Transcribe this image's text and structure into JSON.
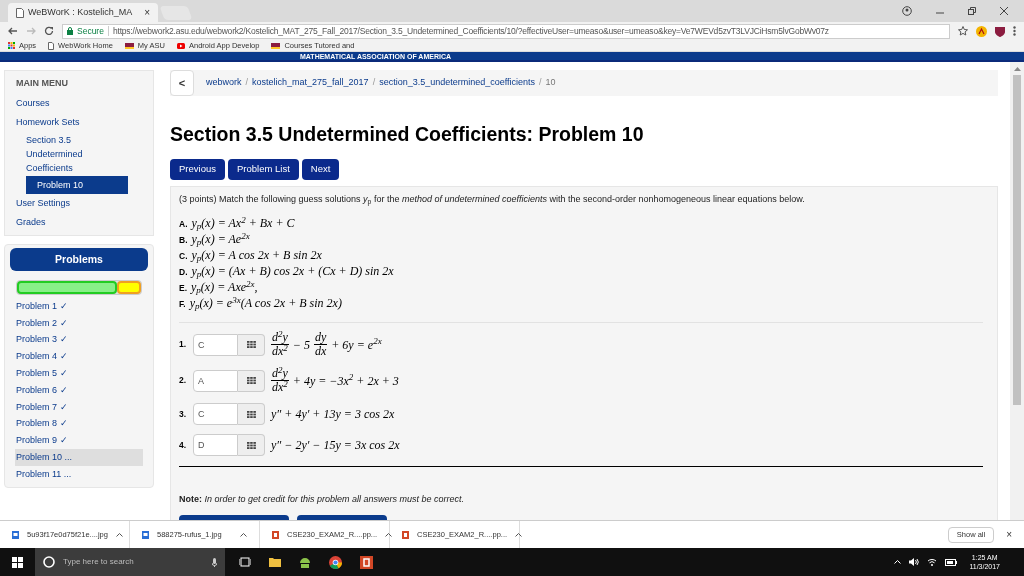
{
  "browser": {
    "tab": {
      "title": "WeBWorK : Kostelich_MA",
      "close": "×"
    },
    "secure": "Secure",
    "url": "https://webwork2.asu.edu/webwork2/Kostelich_MAT_275_Fall_2017/Section_3.5_Undetermined_Coefficients/10/?effectiveUser=umeaso&user=umeaso&key=Ve7WEVd5zvT3LVJCiHsm5lvGobWv07z",
    "bookmarks": [
      {
        "label": "Apps",
        "kind": "apps"
      },
      {
        "label": "WebWork Home",
        "kind": "page"
      },
      {
        "label": "My ASU",
        "kind": "asu"
      },
      {
        "label": "Android App Develop",
        "kind": "youtube"
      },
      {
        "label": "Courses Tutored and",
        "kind": "asu"
      }
    ]
  },
  "banner": {
    "text": "MATHEMATICAL ASSOCIATION OF AMERICA"
  },
  "sidebar": {
    "menu_title": "MAIN MENU",
    "items": [
      {
        "label": "Courses",
        "selected": false
      },
      {
        "label": "Homework Sets",
        "selected": false,
        "children": [
          {
            "label": "Section 3.5 Undetermined Coefficients",
            "selected": false,
            "children": [
              {
                "label": "Problem 10",
                "selected": true
              }
            ]
          }
        ]
      },
      {
        "label": "User Settings",
        "selected": false
      },
      {
        "label": "Grades",
        "selected": false
      }
    ],
    "problems_title": "Problems",
    "progress": {
      "level": 0.81
    },
    "problems": [
      {
        "label": "Problem 1 ✓",
        "selected": false
      },
      {
        "label": "Problem 2 ✓",
        "selected": false
      },
      {
        "label": "Problem 3 ✓",
        "selected": false
      },
      {
        "label": "Problem 4 ✓",
        "selected": false
      },
      {
        "label": "Problem 5 ✓",
        "selected": false
      },
      {
        "label": "Problem 6 ✓",
        "selected": false
      },
      {
        "label": "Problem 7 ✓",
        "selected": false
      },
      {
        "label": "Problem 8 ✓",
        "selected": false
      },
      {
        "label": "Problem 9 ✓",
        "selected": false
      },
      {
        "label": "Problem 10 ...",
        "selected": true
      },
      {
        "label": "Problem 11 ...",
        "selected": false
      }
    ]
  },
  "breadcrumb": {
    "back": "<",
    "links": [
      "webwork",
      "kostelich_mat_275_fall_2017",
      "section_3.5_undetermined_coefficients"
    ],
    "current": "10",
    "separator": "/"
  },
  "title": "Section 3.5 Undetermined Coefficients: Problem 10",
  "buttons": [
    "Previous",
    "Problem List",
    "Next"
  ],
  "problem": {
    "intro": "(3 points) Match the following guess solutions *y*$_{p}$ for the *method of undetermined coefficients* with the second-order nonhomogeneous linear equations below.",
    "options": [
      {
        "letter": "A.",
        "formula": "y$_{p}$(x) = Ax$^{2}$ + Bx + C"
      },
      {
        "letter": "B.",
        "formula": "y$_{p}$(x) = Ae$^{2x}$"
      },
      {
        "letter": "C.",
        "formula": "y$_{p}$(x) = A cos 2x + B sin 2x"
      },
      {
        "letter": "D.",
        "formula": "y$_{p}$(x) = (Ax + B) cos 2x + (Cx + D) sin 2x"
      },
      {
        "letter": "E.",
        "formula": "y$_{p}$(x) = Axe$^{2x}$,"
      },
      {
        "letter": "F.",
        "formula": "y$_{p}$(x) = e$^{3x}$(A cos 2x + B sin 2x)"
      }
    ],
    "questions": [
      {
        "number": "1.",
        "value": "C",
        "equation": [
          {
            "kind": "frac",
            "num": "d$^{2}$y",
            "den": "dx$^{2}$"
          },
          {
            "kind": "text",
            "text": "− 5"
          },
          {
            "kind": "frac",
            "num": "dy",
            "den": "dx"
          },
          {
            "kind": "text",
            "text": "+ 6y = e$^{2x}$"
          }
        ]
      },
      {
        "number": "2.",
        "value": "A",
        "equation": [
          {
            "kind": "frac",
            "num": "d$^{2}$y",
            "den": "dx$^{2}$"
          },
          {
            "kind": "text",
            "text": "+ 4y = −3x$^{2}$ + 2x + 3"
          }
        ]
      },
      {
        "number": "3.",
        "value": "C",
        "equation": [
          {
            "kind": "text",
            "text": "y″ + 4y′ + 13y = 3 cos 2x"
          }
        ]
      },
      {
        "number": "4.",
        "value": "D",
        "equation": [
          {
            "kind": "text",
            "text": "y″ − 2y′ − 15y = 3x cos 2x"
          }
        ]
      }
    ],
    "note": "**Note:** *In order to get credit for this problem all answers must be correct.*"
  },
  "downloads": {
    "items": [
      {
        "name": "5u93f17e0d75f21e....jpg",
        "kind": "image"
      },
      {
        "name": "588275-rufus_1.jpg",
        "kind": "image"
      },
      {
        "name": "CSE230_EXAM2_R....pp...",
        "kind": "pdf"
      },
      {
        "name": "CSE230_EXAM2_R....pp...",
        "kind": "pdf"
      }
    ],
    "show_all": "Show all",
    "close": "×"
  },
  "taskbar": {
    "search_placeholder": "Type here to search",
    "time": "1:25 AM",
    "date": "11/3/2017"
  }
}
